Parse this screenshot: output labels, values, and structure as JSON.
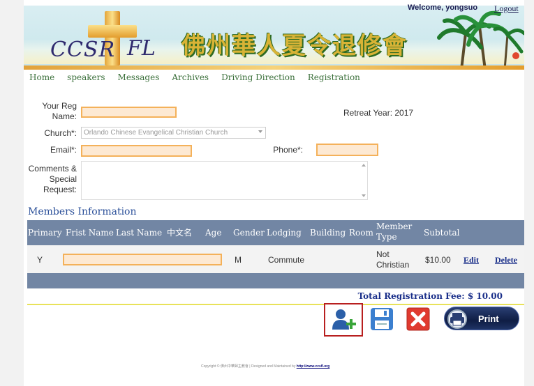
{
  "header": {
    "logo_left": "CCSR",
    "logo_right": "FL",
    "chinese_title": "佛州華人夏令退修會",
    "welcome": "Welcome, yongsuo",
    "logout": "Logout"
  },
  "nav": [
    "Home",
    "speakers",
    "Messages",
    "Archives",
    "Driving Direction",
    "Registration"
  ],
  "form": {
    "reg_name_label": "Your Reg Name:",
    "retreat_year": "Retreat Year: 2017",
    "church_label": "Church*:",
    "church_value": "Orlando Chinese Evangelical Christian Church",
    "email_label": "Email*:",
    "phone_label": "Phone*:",
    "comments_label": "Comments & Special Request:"
  },
  "members": {
    "title": "Members Information",
    "columns": [
      "Primary",
      "Frist Name",
      "Last Name",
      "中文名",
      "Age",
      "Gender",
      "Lodging",
      "Building",
      "Room",
      "Member Type",
      "Subtotal"
    ],
    "rows": [
      {
        "primary": "Y",
        "gender": "M",
        "lodging": "Commute",
        "member_type": "Not Christian",
        "subtotal": "$10.00",
        "edit": "Edit",
        "delete": "Delete"
      }
    ]
  },
  "total": "Total Registration Fee: $ 10.00",
  "print_label": "Print",
  "footer": {
    "text": "Copyright © 佛州中華歸主教會 | Designed and Maintained by",
    "link": "http://www.ccsfl.org"
  },
  "colors": {
    "table_header": "#7286a4",
    "nav_text": "#3a6f3a",
    "input_bg": "#fde9d3",
    "input_border": "#f4b15a",
    "highlight_border": "#b81f1f"
  }
}
